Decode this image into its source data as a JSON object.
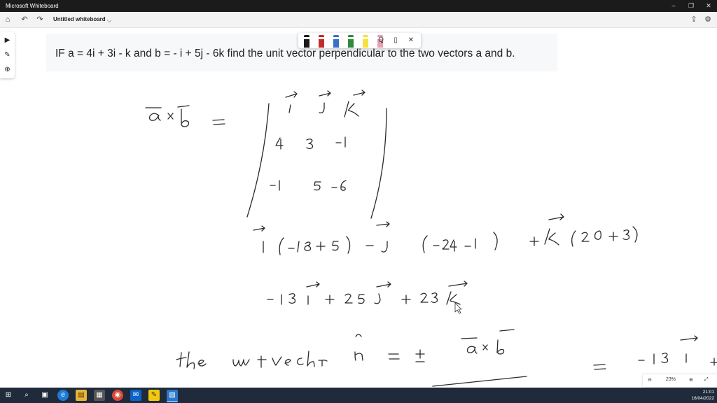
{
  "window": {
    "title": "Microsoft Whiteboard",
    "minimize": "–",
    "restore": "❐",
    "close": "✕"
  },
  "toolbar": {
    "home_icon": "⌂",
    "undo_icon": "↶",
    "redo_icon": "↷",
    "doc_title": "Untitled whiteboard",
    "chevron": "⌵",
    "share_icon": "⇪",
    "settings_icon": "⚙"
  },
  "leftbar": {
    "select_icon": "▶",
    "ink_icon": "✎",
    "add_icon": "⊕"
  },
  "inktray": {
    "pen_colors": [
      "#1a1a1a",
      "#c42b2b",
      "#3a6fcb",
      "#2f8a3e",
      "#f5e23a",
      "#e8a0b4"
    ],
    "lasso_icon": "Ꝗ",
    "ruler_icon": "▯",
    "close_icon": "✕"
  },
  "question": {
    "text": "IF a = 4i + 3i - k and b = - i + 5j - 6k find the unit vector perpendicular to the two vectors a and b."
  },
  "zoom": {
    "zoom_out_icon": "⊖",
    "level": "23%",
    "zoom_in_icon": "⊕",
    "fit_icon": "⤢"
  },
  "taskbar": {
    "icons": [
      "⊞",
      "⌕",
      "▣",
      "e",
      "▤",
      "▦",
      "◉",
      "✉",
      "✎",
      "▧"
    ],
    "time": "21:01",
    "date": "16/04/2022"
  }
}
